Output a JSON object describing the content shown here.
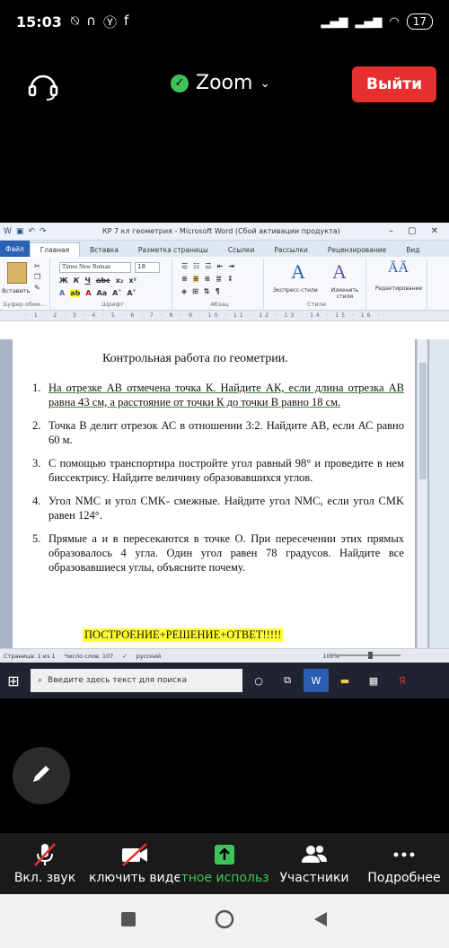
{
  "status_bar": {
    "time": "15:03",
    "battery": "17"
  },
  "zoom_header": {
    "title": "Zoom",
    "exit_label": "Выйти"
  },
  "word": {
    "window_title": "КР 7 кл геометрия - Microsoft Word (Сбой активации продукта)",
    "tabs": [
      "Файл",
      "Главная",
      "Вставка",
      "Разметка страницы",
      "Ссылки",
      "Рассылки",
      "Рецензирование",
      "Вид"
    ],
    "font_name": "Times New Roman",
    "font_size": "18",
    "group_labels": {
      "clipboard": "Буфер обме...",
      "font": "Шрифт",
      "paragraph": "Абзац",
      "styles": "Стили"
    },
    "buttons": {
      "paste": "Вставить",
      "express_styles": "Экспресс-стили",
      "change_styles": "Изменить стили",
      "editing": "Редактирование"
    },
    "document": {
      "title": "Контрольная работа по геометрии.",
      "questions": [
        {
          "num": "1.",
          "text": "На отрезке АВ отмечена точка К. Найдите АК, если длина отрезка АВ равна 43 см, а расстояние от точки К до точки В равно 18 см."
        },
        {
          "num": "2.",
          "text": "Точка В делит отрезок АС в отношении 3:2. Найдите АВ, если АС равно 60 м."
        },
        {
          "num": "3.",
          "text": "С помощью транспортира постройте угол равный 98° и проведите в нем биссектрису. Найдите величину образовавшихся углов."
        },
        {
          "num": "4.",
          "text": "Угол NMC и угол СМK- смежные. Найдите угол NMC, если угол СМK равен 124°."
        },
        {
          "num": "5.",
          "text": "Прямые а и в пересекаются в точке О. При пересечении этих прямых образовалось 4 угла. Один угол равен 78 градусов. Найдите все образовавшиеся углы, объясните почему."
        }
      ],
      "highlight": "ПОСТРОЕНИЕ+РЕШЕНИЕ+ОТВЕТ!!!!!"
    },
    "status": {
      "page": "Страница: 1 из 1",
      "words": "Число слов: 107",
      "language": "русский",
      "zoom": "100%"
    },
    "taskbar_search": "Введите здесь текст для поиска"
  },
  "controls": [
    {
      "label": "Вкл. звук",
      "icon": "mic-muted-icon"
    },
    {
      "label": "Включить видео",
      "icon": "video-off-icon"
    },
    {
      "label": "Совместное использование",
      "icon": "share-icon"
    },
    {
      "label": "Участники",
      "icon": "participants-icon"
    },
    {
      "label": "Подробнее",
      "icon": "more-icon"
    }
  ],
  "colors": {
    "exit": "#e5302f",
    "share_green": "#3ec35a",
    "highlight_yellow": "#ffff33"
  }
}
